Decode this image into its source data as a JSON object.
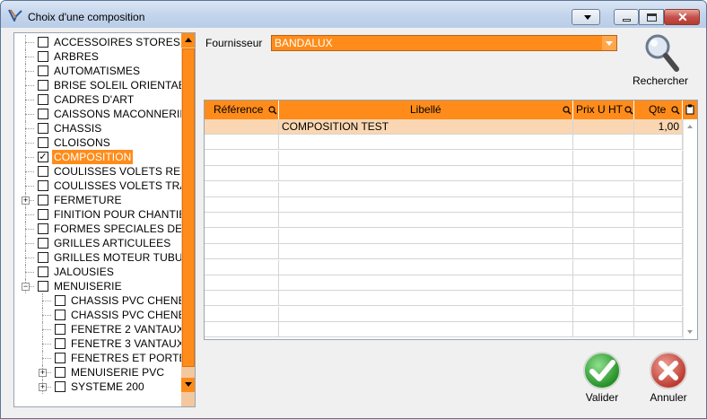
{
  "window": {
    "title": "Choix d'une composition"
  },
  "tree": {
    "items": [
      {
        "label": "ACCESSOIRES STORES L",
        "checked": false,
        "level": 0,
        "expander": ""
      },
      {
        "label": "ARBRES",
        "checked": false,
        "level": 0,
        "expander": ""
      },
      {
        "label": "AUTOMATISMES",
        "checked": false,
        "level": 0,
        "expander": ""
      },
      {
        "label": "BRISE SOLEIL ORIENTAB",
        "checked": false,
        "level": 0,
        "expander": ""
      },
      {
        "label": "CADRES D'ART",
        "checked": false,
        "level": 0,
        "expander": ""
      },
      {
        "label": "CAISSONS MACONNERIE",
        "checked": false,
        "level": 0,
        "expander": ""
      },
      {
        "label": "CHASSIS",
        "checked": false,
        "level": 0,
        "expander": ""
      },
      {
        "label": "CLOISONS",
        "checked": false,
        "level": 0,
        "expander": ""
      },
      {
        "label": "COMPOSITION",
        "checked": true,
        "level": 0,
        "expander": "",
        "selected": true
      },
      {
        "label": "COULISSES VOLETS REN",
        "checked": false,
        "level": 0,
        "expander": ""
      },
      {
        "label": "COULISSES VOLETS TRA",
        "checked": false,
        "level": 0,
        "expander": ""
      },
      {
        "label": "FERMETURE",
        "checked": false,
        "level": 0,
        "expander": "+"
      },
      {
        "label": "FINITION POUR CHANTIE",
        "checked": false,
        "level": 0,
        "expander": ""
      },
      {
        "label": "FORMES SPECIALES DE M",
        "checked": false,
        "level": 0,
        "expander": ""
      },
      {
        "label": "GRILLES ARTICULEES",
        "checked": false,
        "level": 0,
        "expander": ""
      },
      {
        "label": "GRILLES MOTEUR TUBUL",
        "checked": false,
        "level": 0,
        "expander": ""
      },
      {
        "label": "JALOUSIES",
        "checked": false,
        "level": 0,
        "expander": ""
      },
      {
        "label": "MENUISERIE",
        "checked": false,
        "level": 0,
        "expander": "−"
      },
      {
        "label": "CHASSIS PVC CHENE",
        "checked": false,
        "level": 1,
        "expander": ""
      },
      {
        "label": "CHASSIS PVC CHENE",
        "checked": false,
        "level": 1,
        "expander": ""
      },
      {
        "label": "FENETRE 2 VANTAUX",
        "checked": false,
        "level": 1,
        "expander": ""
      },
      {
        "label": "FENETRE 3 VANTAUX",
        "checked": false,
        "level": 1,
        "expander": ""
      },
      {
        "label": "FENETRES ET PORTES",
        "checked": false,
        "level": 1,
        "expander": ""
      },
      {
        "label": "MENUISERIE PVC",
        "checked": false,
        "level": 1,
        "expander": "+"
      },
      {
        "label": "SYSTEME 200",
        "checked": false,
        "level": 1,
        "expander": "+"
      }
    ]
  },
  "supplier": {
    "label": "Fournisseur",
    "value": "BANDALUX"
  },
  "search": {
    "label": "Rechercher",
    "icon": "magnifier-icon"
  },
  "table": {
    "columns": [
      "Référence",
      "Libellé",
      "Prix U HT",
      "Qte"
    ],
    "rows": [
      {
        "reference": "",
        "libelle": "COMPOSITION TEST",
        "prix": "",
        "qte": "1,00"
      }
    ]
  },
  "actions": {
    "validate": "Valider",
    "cancel": "Annuler"
  },
  "colors": {
    "accent": "#ff8c1a",
    "selected_row": "#fad7b2",
    "validate": "#3aa83a",
    "cancel": "#d24a3c"
  }
}
